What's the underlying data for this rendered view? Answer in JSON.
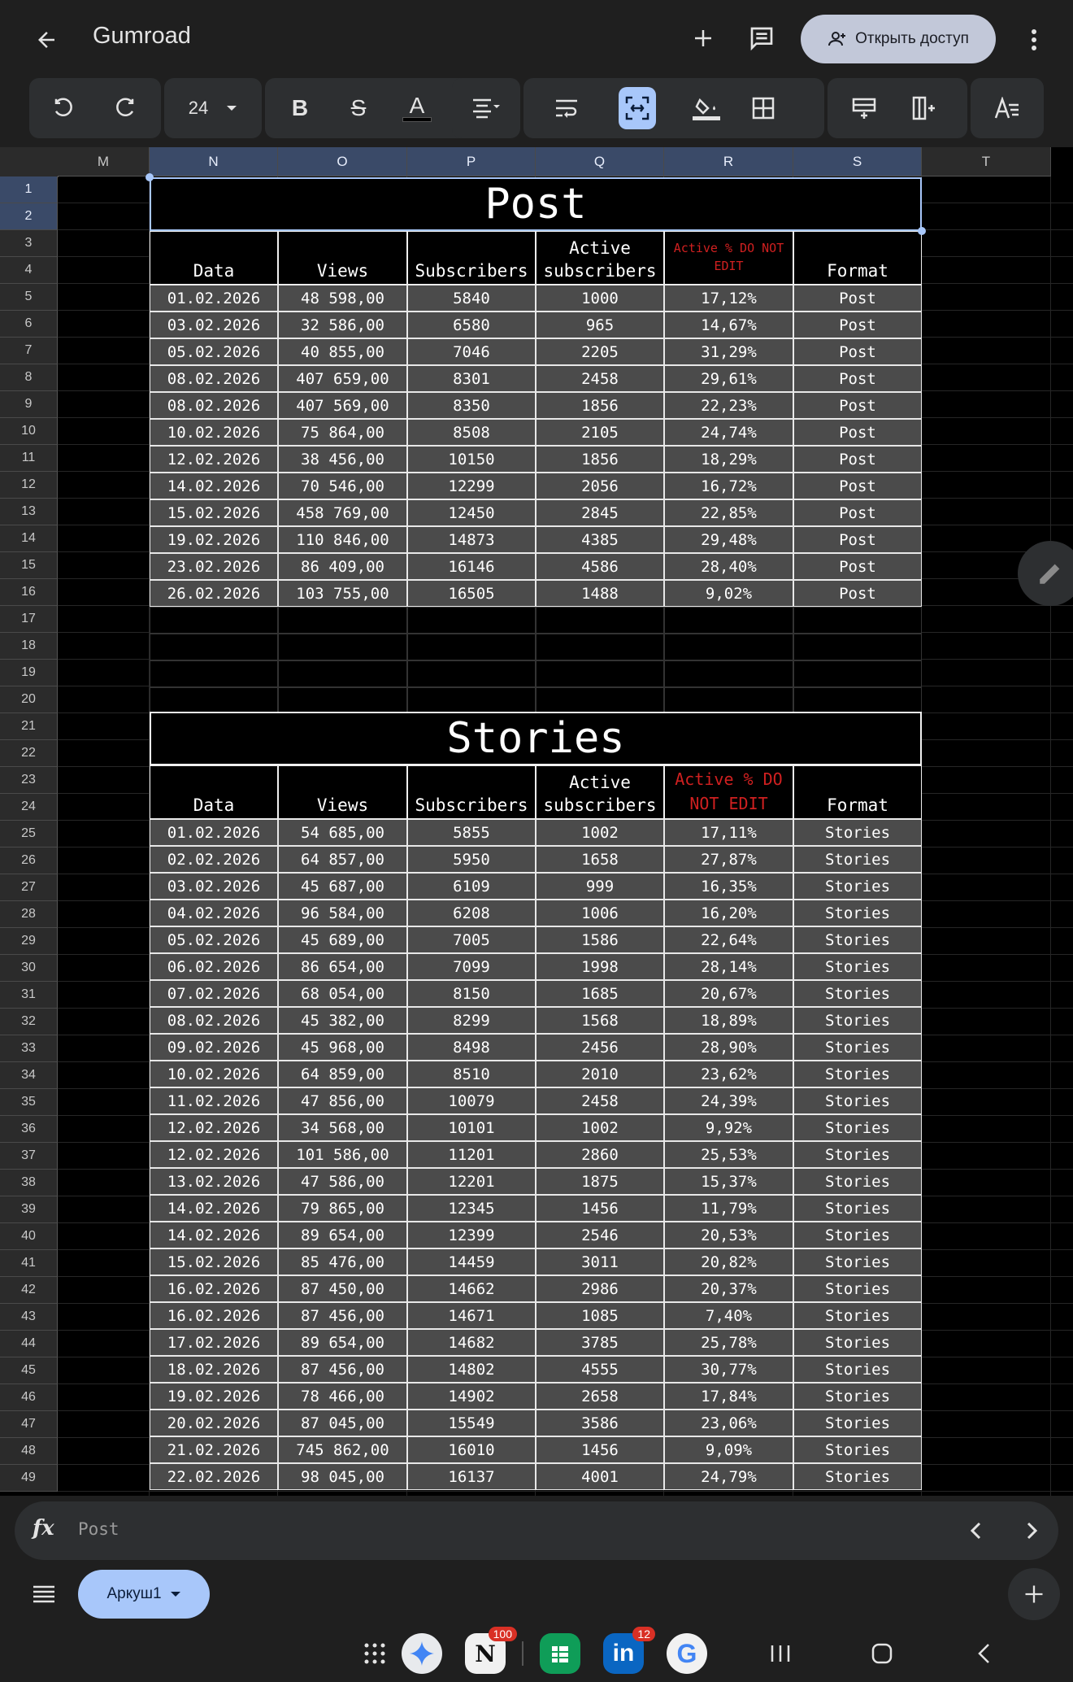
{
  "header": {
    "title": "Gumroad",
    "share_label": "Открыть доступ"
  },
  "toolbar": {
    "font_size": "24"
  },
  "grid": {
    "columns": [
      "M",
      "N",
      "O",
      "P",
      "Q",
      "R",
      "S",
      "T"
    ],
    "rows": [
      "1",
      "2",
      "3",
      "4",
      "5",
      "6",
      "7",
      "8",
      "9",
      "10",
      "11",
      "12",
      "13",
      "14",
      "15",
      "16",
      "17",
      "18",
      "19",
      "20",
      "21",
      "22",
      "23",
      "24",
      "25",
      "26",
      "27",
      "28",
      "29",
      "30",
      "31",
      "32",
      "33",
      "34",
      "35",
      "36",
      "37",
      "38",
      "39",
      "40",
      "41",
      "42",
      "43",
      "44",
      "45",
      "46",
      "47",
      "48",
      "49"
    ]
  },
  "post": {
    "title": "Post",
    "headers": [
      "Data",
      "Views",
      "Subscribers",
      "Active subscribers",
      "Active % DO NOT EDIT",
      "Format"
    ],
    "rows": [
      [
        "01.02.2026",
        "48 598,00",
        "5840",
        "1000",
        "17,12%",
        "Post"
      ],
      [
        "03.02.2026",
        "32 586,00",
        "6580",
        "965",
        "14,67%",
        "Post"
      ],
      [
        "05.02.2026",
        "40 855,00",
        "7046",
        "2205",
        "31,29%",
        "Post"
      ],
      [
        "08.02.2026",
        "407 659,00",
        "8301",
        "2458",
        "29,61%",
        "Post"
      ],
      [
        "08.02.2026",
        "407 569,00",
        "8350",
        "1856",
        "22,23%",
        "Post"
      ],
      [
        "10.02.2026",
        "75 864,00",
        "8508",
        "2105",
        "24,74%",
        "Post"
      ],
      [
        "12.02.2026",
        "38 456,00",
        "10150",
        "1856",
        "18,29%",
        "Post"
      ],
      [
        "14.02.2026",
        "70 546,00",
        "12299",
        "2056",
        "16,72%",
        "Post"
      ],
      [
        "15.02.2026",
        "458 769,00",
        "12450",
        "2845",
        "22,85%",
        "Post"
      ],
      [
        "19.02.2026",
        "110 846,00",
        "14873",
        "4385",
        "29,48%",
        "Post"
      ],
      [
        "23.02.2026",
        "86 409,00",
        "16146",
        "4586",
        "28,40%",
        "Post"
      ],
      [
        "26.02.2026",
        "103 755,00",
        "16505",
        "1488",
        "9,02%",
        "Post"
      ]
    ]
  },
  "stories": {
    "title": "Stories",
    "headers": [
      "Data",
      "Views",
      "Subscribers",
      "Active subscribers",
      "Active % DO NOT EDIT",
      "Format"
    ],
    "rows": [
      [
        "01.02.2026",
        "54 685,00",
        "5855",
        "1002",
        "17,11%",
        "Stories"
      ],
      [
        "02.02.2026",
        "64 857,00",
        "5950",
        "1658",
        "27,87%",
        "Stories"
      ],
      [
        "03.02.2026",
        "45 687,00",
        "6109",
        "999",
        "16,35%",
        "Stories"
      ],
      [
        "04.02.2026",
        "96 584,00",
        "6208",
        "1006",
        "16,20%",
        "Stories"
      ],
      [
        "05.02.2026",
        "45 689,00",
        "7005",
        "1586",
        "22,64%",
        "Stories"
      ],
      [
        "06.02.2026",
        "86 654,00",
        "7099",
        "1998",
        "28,14%",
        "Stories"
      ],
      [
        "07.02.2026",
        "68 054,00",
        "8150",
        "1685",
        "20,67%",
        "Stories"
      ],
      [
        "08.02.2026",
        "45 382,00",
        "8299",
        "1568",
        "18,89%",
        "Stories"
      ],
      [
        "09.02.2026",
        "45 968,00",
        "8498",
        "2456",
        "28,90%",
        "Stories"
      ],
      [
        "10.02.2026",
        "64 859,00",
        "8510",
        "2010",
        "23,62%",
        "Stories"
      ],
      [
        "11.02.2026",
        "47 856,00",
        "10079",
        "2458",
        "24,39%",
        "Stories"
      ],
      [
        "12.02.2026",
        "34 568,00",
        "10101",
        "1002",
        "9,92%",
        "Stories"
      ],
      [
        "12.02.2026",
        "101 586,00",
        "11201",
        "2860",
        "25,53%",
        "Stories"
      ],
      [
        "13.02.2026",
        "47 586,00",
        "12201",
        "1875",
        "15,37%",
        "Stories"
      ],
      [
        "14.02.2026",
        "79 865,00",
        "12345",
        "1456",
        "11,79%",
        "Stories"
      ],
      [
        "14.02.2026",
        "89 654,00",
        "12399",
        "2546",
        "20,53%",
        "Stories"
      ],
      [
        "15.02.2026",
        "85 476,00",
        "14459",
        "3011",
        "20,82%",
        "Stories"
      ],
      [
        "16.02.2026",
        "87 450,00",
        "14662",
        "2986",
        "20,37%",
        "Stories"
      ],
      [
        "16.02.2026",
        "87 456,00",
        "14671",
        "1085",
        "7,40%",
        "Stories"
      ],
      [
        "17.02.2026",
        "89 654,00",
        "14682",
        "3785",
        "25,78%",
        "Stories"
      ],
      [
        "18.02.2026",
        "87 456,00",
        "14802",
        "4555",
        "30,77%",
        "Stories"
      ],
      [
        "19.02.2026",
        "78 466,00",
        "14902",
        "2658",
        "17,84%",
        "Stories"
      ],
      [
        "20.02.2026",
        "87 045,00",
        "15549",
        "3586",
        "23,06%",
        "Stories"
      ],
      [
        "21.02.2026",
        "745 862,00",
        "16010",
        "1456",
        "9,09%",
        "Stories"
      ],
      [
        "22.02.2026",
        "98 045,00",
        "16137",
        "4001",
        "24,79%",
        "Stories"
      ]
    ]
  },
  "formula_bar": {
    "value": "Post"
  },
  "sheets": {
    "active": "Аркуш1"
  },
  "taskbar": {
    "badges": {
      "notion": "100",
      "linkedin": "12"
    }
  },
  "colors": {
    "accent": "#a8c7fa",
    "warning_header": "#d02020",
    "cell_fill": "#4b4b4b",
    "sheets_green": "#0f9d58",
    "linkedin_blue": "#0a66c2"
  }
}
